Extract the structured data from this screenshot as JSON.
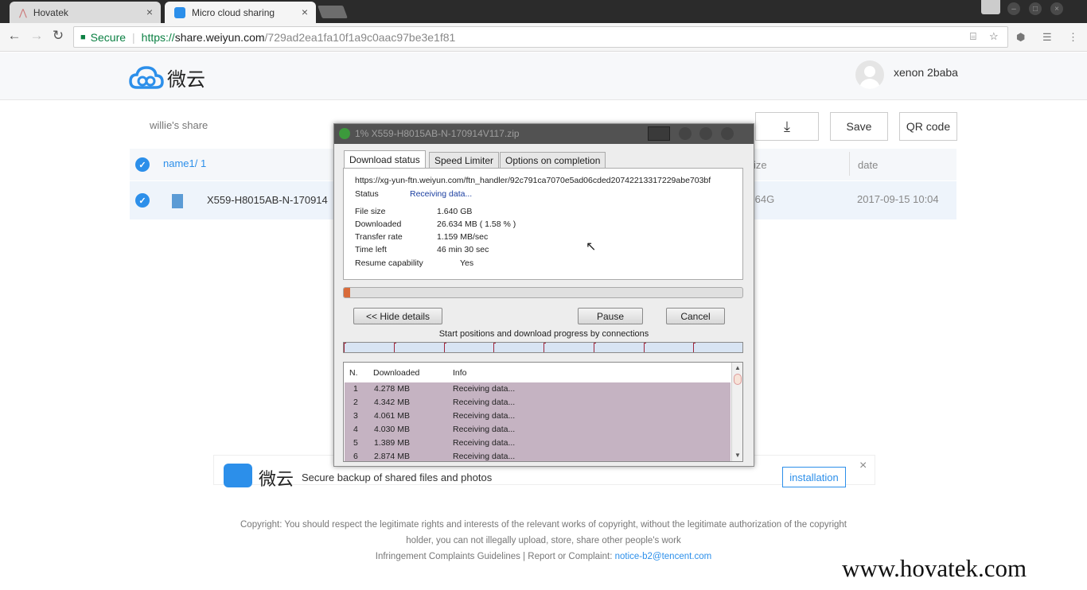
{
  "browser": {
    "tabs": [
      {
        "title": "Hovatek",
        "close": "×"
      },
      {
        "title": "Micro cloud sharing",
        "close": "×"
      }
    ],
    "nav": {
      "back": "←",
      "forward": "→",
      "reload": "↻"
    },
    "address": {
      "secure_label": "Secure",
      "scheme": "https://",
      "host": "share.weiyun.com",
      "path": "/729ad2ea1fa10f1a9c0aac97be3e1f81"
    }
  },
  "site": {
    "brand": "微云",
    "username": "xenon 2baba",
    "share_title": "willie's share",
    "buttons": {
      "download": "⤓",
      "save": "Save",
      "qr": "QR code"
    },
    "list": {
      "name_header": "name1/ 1",
      "size_header": "ize",
      "date_header": "date",
      "file_name": "X559-H8015AB-N-170914",
      "file_size": ".64G",
      "file_date": "2017-09-15 10:04"
    },
    "banner": {
      "brand": "微云",
      "text": "Secure backup of shared files and photos",
      "install": "installation",
      "close": "×"
    },
    "footer": {
      "line1": "Copyright: You should respect the legitimate rights and interests of the relevant works of copyright, without the legitimate authorization of the copyright",
      "line2": "holder, you can not illegally upload, store, share other people's work",
      "line3": "Infringement Complaints Guidelines | Report or Complaint: ",
      "email": "notice-b2@tencent.com"
    }
  },
  "dialog": {
    "title": "1% X559-H8015AB-N-170914V117.zip",
    "tabs": [
      "Download status",
      "Speed Limiter",
      "Options on completion"
    ],
    "url": "https://xg-yun-ftn.weiyun.com/ftn_handler/92c791ca7070e5ad06cded20742213317229abe703bf",
    "status_label": "Status",
    "status_value": "Receiving data...",
    "file_size_label": "File size",
    "file_size_value": "1.640  GB",
    "downloaded_label": "Downloaded",
    "downloaded_value": "26.634  MB  ( 1.58 % )",
    "rate_label": "Transfer rate",
    "rate_value": "1.159  MB/sec",
    "time_label": "Time left",
    "time_value": "46 min 30 sec",
    "resume_label": "Resume capability",
    "resume_value": "Yes",
    "progress_percent": 1.58,
    "buttons": {
      "hide": "<< Hide details",
      "pause": "Pause",
      "cancel": "Cancel"
    },
    "connections_label": "Start positions and download progress by connections",
    "table_headers": {
      "n": "N.",
      "downloaded": "Downloaded",
      "info": "Info"
    },
    "connections": [
      {
        "n": "1",
        "downloaded": "4.278  MB",
        "info": "Receiving data..."
      },
      {
        "n": "2",
        "downloaded": "4.342  MB",
        "info": "Receiving data..."
      },
      {
        "n": "3",
        "downloaded": "4.061  MB",
        "info": "Receiving data..."
      },
      {
        "n": "4",
        "downloaded": "4.030  MB",
        "info": "Receiving data..."
      },
      {
        "n": "5",
        "downloaded": "1.389  MB",
        "info": "Receiving data..."
      },
      {
        "n": "6",
        "downloaded": "2.874  MB",
        "info": "Receiving data..."
      }
    ]
  },
  "watermark": "www.hovatek.com",
  "colors": {
    "accent": "#2c8fea",
    "secure": "#0b8043",
    "progress": "#d96b3a"
  }
}
